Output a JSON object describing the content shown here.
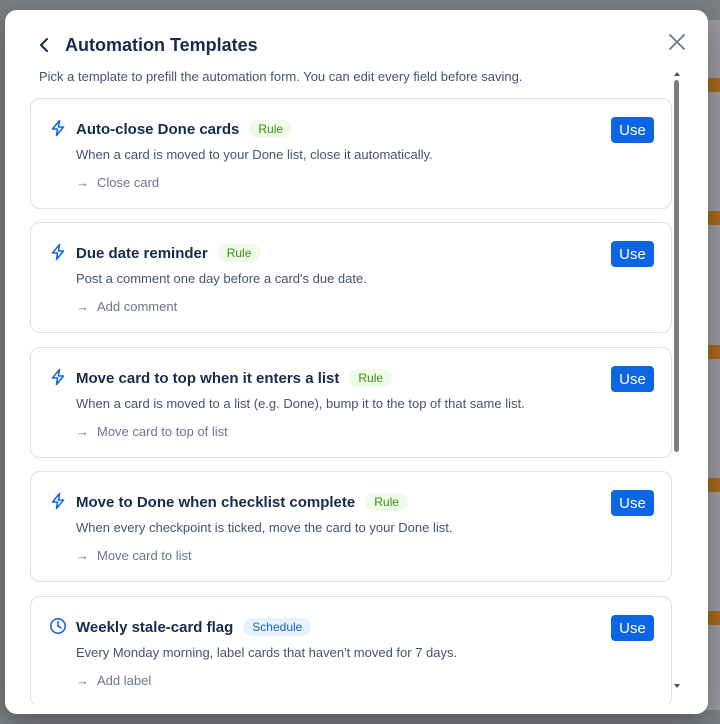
{
  "modal": {
    "title": "Automation Templates",
    "subtitle": "Pick a template to prefill the automation form. You can edit every field before saving."
  },
  "templates": [
    {
      "name": "Auto-close Done cards",
      "badge": "Rule",
      "icon": "lightning-icon",
      "description": "When a card is moved to your Done list, close it automatically.",
      "action": "Close card",
      "button": "Use"
    },
    {
      "name": "Due date reminder",
      "badge": "Rule",
      "icon": "lightning-icon",
      "description": "Post a comment one day before a card's due date.",
      "action": "Add comment",
      "button": "Use"
    },
    {
      "name": "Move card to top when it enters a list",
      "badge": "Rule",
      "icon": "lightning-icon",
      "description": "When a card is moved to a list (e.g. Done), bump it to the top of that same list.",
      "action": "Move card to top of list",
      "button": "Use"
    },
    {
      "name": "Move to Done when checklist complete",
      "badge": "Rule",
      "icon": "lightning-icon",
      "description": "When every checkpoint is ticked, move the card to your Done list.",
      "action": "Move card to list",
      "button": "Use"
    },
    {
      "name": "Weekly stale-card flag",
      "badge": "Schedule",
      "icon": "clock-icon",
      "description": "Every Monday morning, label cards that haven't moved for 7 days.",
      "action": "Add label",
      "button": "Use"
    }
  ],
  "colors": {
    "primary_button": "#0c66e4",
    "rule_badge_bg": "#eefbe8",
    "rule_badge_text": "#3d8a12",
    "schedule_badge_bg": "#e6f2ff",
    "schedule_badge_text": "#1561c5",
    "icon_accent": "#1868db"
  }
}
